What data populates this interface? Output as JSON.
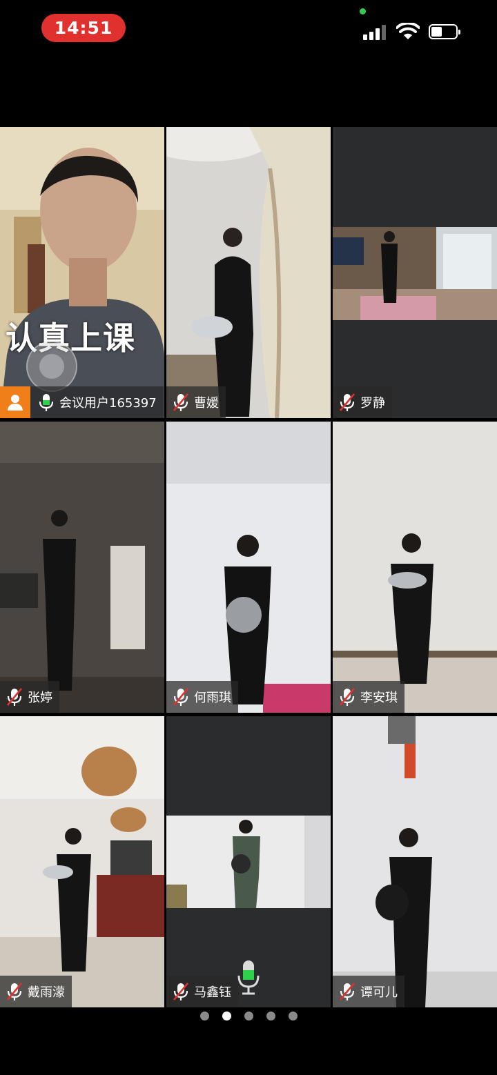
{
  "status_bar": {
    "time": "14:51",
    "time_pill_color": "#e0312f",
    "privacy_dot_color": "#2fcf54",
    "signal_icon": "cellular-signal-icon",
    "wifi_icon": "wifi-icon",
    "battery_icon": "battery-icon",
    "battery_level": 0.45
  },
  "meeting": {
    "caption": "认真上课",
    "active_speaker_color": "#2fd04b",
    "host_badge_color": "#f07f1a",
    "participants": [
      {
        "name": "会议用户165397",
        "mic": "on",
        "host": true,
        "active": true
      },
      {
        "name": "曹媛",
        "mic": "muted"
      },
      {
        "name": "罗静",
        "mic": "muted"
      },
      {
        "name": "张婷",
        "mic": "muted"
      },
      {
        "name": "何雨琪",
        "mic": "muted"
      },
      {
        "name": "李安琪",
        "mic": "muted"
      },
      {
        "name": "戴雨濛",
        "mic": "muted"
      },
      {
        "name": "马鑫钰",
        "mic": "muted"
      },
      {
        "name": "谭可儿",
        "mic": "muted"
      }
    ]
  },
  "pagination": {
    "pages": 5,
    "current": 2
  }
}
